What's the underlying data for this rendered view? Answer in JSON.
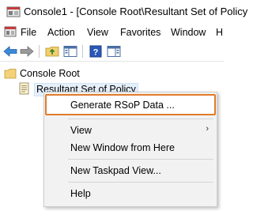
{
  "window": {
    "title": "Console1 - [Console Root\\Resultant Set of Policy"
  },
  "menubar": {
    "items": [
      "File",
      "Action",
      "View",
      "Favorites",
      "Window",
      "H"
    ]
  },
  "toolbar": {
    "buttons": [
      "back-icon",
      "forward-icon",
      "up-folder-icon",
      "show-hide-tree-icon",
      "help-icon",
      "action-pane-icon"
    ]
  },
  "tree": {
    "root_label": "Console Root",
    "child_label": "Resultant Set of Policy"
  },
  "context_menu": {
    "generate": "Generate RSoP Data ...",
    "view": "View",
    "view_arrow": "›",
    "new_window": "New Window from Here",
    "new_taskpad": "New Taskpad View...",
    "help": "Help"
  },
  "colors": {
    "highlight_border": "#e07b2a",
    "selection_bg": "#e5f0fb",
    "menu_bg": "#f2f2f2"
  }
}
